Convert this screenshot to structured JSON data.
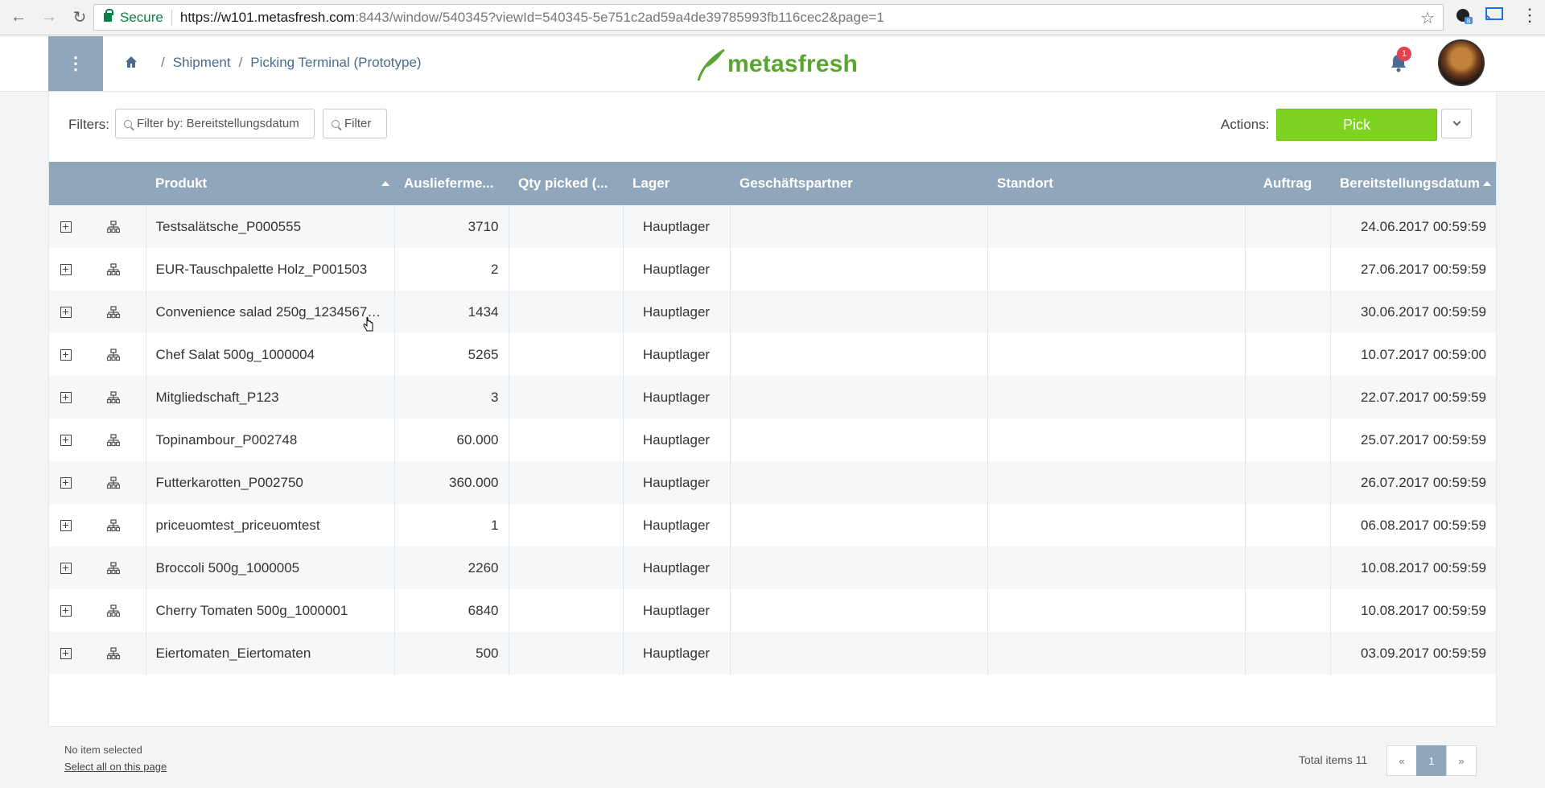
{
  "browser": {
    "secure_label": "Secure",
    "url_host": "https://w101.metasfresh.com",
    "url_rest": ":8443/window/540345?viewId=540345-5e751c2ad59a4de39785993fb116cec2&page=1",
    "ext_badge": "8"
  },
  "header": {
    "breadcrumb": [
      "Shipment",
      "Picking Terminal (Prototype)"
    ],
    "logo_text": "metasfresh",
    "notification_count": "1",
    "menu_icon": "⋮"
  },
  "filters": {
    "label": "Filters:",
    "date_filter": "Filter by: Bereitstellungsdatum",
    "filter_button": "Filter"
  },
  "actions": {
    "label": "Actions:",
    "pick": "Pick"
  },
  "table": {
    "columns": [
      "Produkt",
      "Auslieferme...",
      "Qty picked (...",
      "Lager",
      "Geschäftspartner",
      "Standort",
      "Auftrag",
      "Bereitstellungsdatum"
    ],
    "rows": [
      {
        "produkt": "Testsalätsche_P000555",
        "menge": "3710",
        "picked": "",
        "lager": "Hauptlager",
        "partner": "",
        "standort": "",
        "auftrag": "",
        "datum": "24.06.2017 00:59:59"
      },
      {
        "produkt": "EUR-Tauschpalette Holz_P001503",
        "menge": "2",
        "picked": "",
        "lager": "Hauptlager",
        "partner": "",
        "standort": "",
        "auftrag": "",
        "datum": "27.06.2017 00:59:59"
      },
      {
        "produkt": "Convenience salad 250g_12345678...",
        "menge": "1434",
        "picked": "",
        "lager": "Hauptlager",
        "partner": "",
        "standort": "",
        "auftrag": "",
        "datum": "30.06.2017 00:59:59"
      },
      {
        "produkt": "Chef Salat 500g_1000004",
        "menge": "5265",
        "picked": "",
        "lager": "Hauptlager",
        "partner": "",
        "standort": "",
        "auftrag": "",
        "datum": "10.07.2017 00:59:00"
      },
      {
        "produkt": "Mitgliedschaft_P123",
        "menge": "3",
        "picked": "",
        "lager": "Hauptlager",
        "partner": "",
        "standort": "",
        "auftrag": "",
        "datum": "22.07.2017 00:59:59"
      },
      {
        "produkt": "Topinambour_P002748",
        "menge": "60.000",
        "picked": "",
        "lager": "Hauptlager",
        "partner": "",
        "standort": "",
        "auftrag": "",
        "datum": "25.07.2017 00:59:59"
      },
      {
        "produkt": "Futterkarotten_P002750",
        "menge": "360.000",
        "picked": "",
        "lager": "Hauptlager",
        "partner": "",
        "standort": "",
        "auftrag": "",
        "datum": "26.07.2017 00:59:59"
      },
      {
        "produkt": "priceuomtest_priceuomtest",
        "menge": "1",
        "picked": "",
        "lager": "Hauptlager",
        "partner": "",
        "standort": "",
        "auftrag": "",
        "datum": "06.08.2017 00:59:59"
      },
      {
        "produkt": "Broccoli 500g_1000005",
        "menge": "2260",
        "picked": "",
        "lager": "Hauptlager",
        "partner": "",
        "standort": "",
        "auftrag": "",
        "datum": "10.08.2017 00:59:59"
      },
      {
        "produkt": "Cherry Tomaten 500g_1000001",
        "menge": "6840",
        "picked": "",
        "lager": "Hauptlager",
        "partner": "",
        "standort": "",
        "auftrag": "",
        "datum": "10.08.2017 00:59:59"
      },
      {
        "produkt": "Eiertomaten_Eiertomaten",
        "menge": "500",
        "picked": "",
        "lager": "Hauptlager",
        "partner": "",
        "standort": "",
        "auftrag": "",
        "datum": "03.09.2017 00:59:59"
      }
    ]
  },
  "footer": {
    "selection": "No item selected",
    "select_all": "Select all on this page",
    "total": "Total items 11",
    "pager": [
      "«",
      "1",
      "»"
    ]
  },
  "colors": {
    "accent": "#8fa6bb",
    "pick": "#7ed321",
    "brand": "#5aa532",
    "badge": "#e0434d"
  }
}
